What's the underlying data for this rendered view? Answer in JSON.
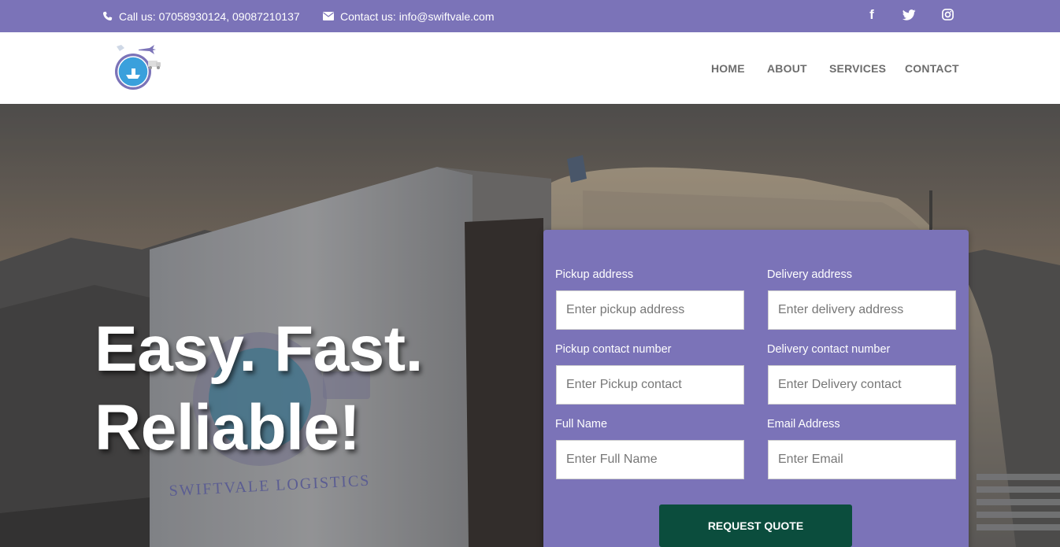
{
  "topbar": {
    "phone_text": "Call us: 07058930124, 09087210137",
    "email_text": "Contact us: info@swiftvale.com",
    "social": [
      {
        "name": "facebook",
        "glyph": "f"
      },
      {
        "name": "twitter"
      },
      {
        "name": "instagram"
      }
    ],
    "bg_color": "#7b73b8"
  },
  "nav": {
    "items": [
      "HOME",
      "ABOUT",
      "SERVICES",
      "CONTACT"
    ]
  },
  "hero": {
    "headline_line1": "Easy. Fast.",
    "headline_line2": "Reliable!",
    "trailer_text": "SWIFTVALE LOGISTICS"
  },
  "form": {
    "pickup_address": {
      "label": "Pickup address",
      "placeholder": "Enter pickup address"
    },
    "delivery_address": {
      "label": "Delivery address",
      "placeholder": "Enter delivery address"
    },
    "pickup_contact": {
      "label": "Pickup contact number",
      "placeholder": "Enter Pickup contact"
    },
    "delivery_contact": {
      "label": "Delivery contact number",
      "placeholder": "Enter Delivery contact"
    },
    "full_name": {
      "label": "Full Name",
      "placeholder": "Enter Full Name"
    },
    "email": {
      "label": "Email Address",
      "placeholder": "Enter Email"
    },
    "submit_label": "REQUEST QUOTE",
    "card_color": "#7b73b8",
    "button_color": "#0b4d3d"
  }
}
